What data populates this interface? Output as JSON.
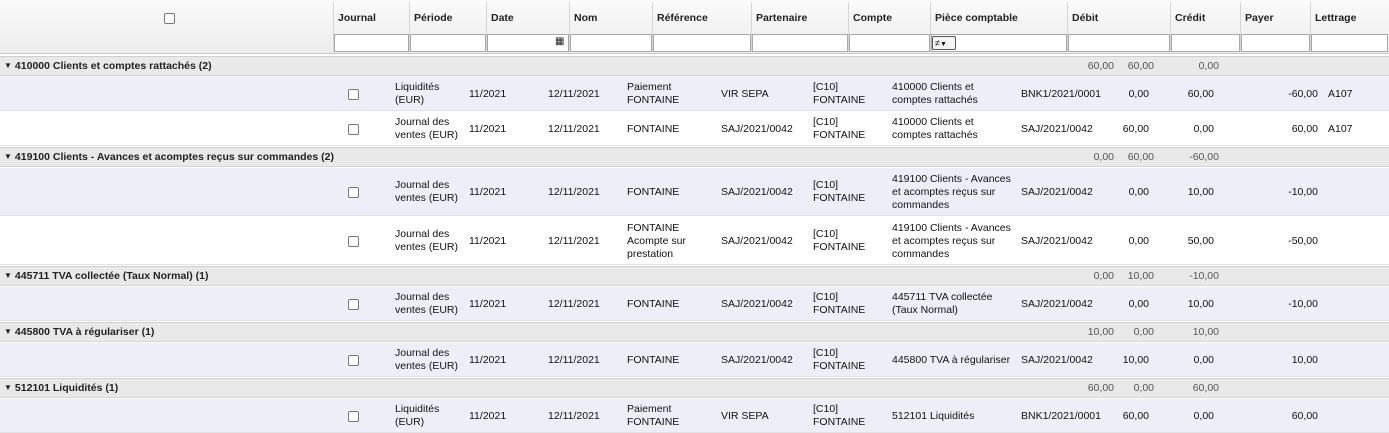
{
  "columns": [
    "Journal",
    "Période",
    "Date",
    "Nom",
    "Référence",
    "Partenaire",
    "Compte",
    "Pièce comptable",
    "Débit",
    "Crédit",
    "Payer",
    "Lettrage"
  ],
  "filter": {
    "piece_operator": "≠"
  },
  "groups": [
    {
      "title": "410000 Clients et comptes rattachés (2)",
      "debit": "60,00",
      "credit": "60,00",
      "payer": "0,00",
      "rows": [
        {
          "journal": "Liquidités (EUR)",
          "periode": "11/2021",
          "date": "12/11/2021",
          "nom": "Paiement FONTAINE",
          "reference": "VIR SEPA",
          "partenaire": "[C10] FONTAINE",
          "compte": "410000 Clients et comptes rattachés",
          "piece": "BNK1/2021/0001",
          "debit": "0,00",
          "credit": "60,00",
          "payer": "-60,00",
          "lettrage": "A107"
        },
        {
          "journal": "Journal des ventes (EUR)",
          "periode": "11/2021",
          "date": "12/11/2021",
          "nom": "FONTAINE",
          "reference": "SAJ/2021/0042",
          "partenaire": "[C10] FONTAINE",
          "compte": "410000 Clients et comptes rattachés",
          "piece": "SAJ/2021/0042",
          "debit": "60,00",
          "credit": "0,00",
          "payer": "60,00",
          "lettrage": "A107"
        }
      ]
    },
    {
      "title": "419100 Clients - Avances et acomptes reçus sur commandes (2)",
      "debit": "0,00",
      "credit": "60,00",
      "payer": "-60,00",
      "rows": [
        {
          "journal": "Journal des ventes (EUR)",
          "periode": "11/2021",
          "date": "12/11/2021",
          "nom": "FONTAINE",
          "reference": "SAJ/2021/0042",
          "partenaire": "[C10] FONTAINE",
          "compte": "419100 Clients - Avances et acomptes reçus sur commandes",
          "piece": "SAJ/2021/0042",
          "debit": "0,00",
          "credit": "10,00",
          "payer": "-10,00",
          "lettrage": ""
        },
        {
          "journal": "Journal des ventes (EUR)",
          "periode": "11/2021",
          "date": "12/11/2021",
          "nom": "FONTAINE Acompte sur prestation",
          "reference": "SAJ/2021/0042",
          "partenaire": "[C10] FONTAINE",
          "compte": "419100 Clients - Avances et acomptes reçus sur commandes",
          "piece": "SAJ/2021/0042",
          "debit": "0,00",
          "credit": "50,00",
          "payer": "-50,00",
          "lettrage": ""
        }
      ]
    },
    {
      "title": "445711 TVA collectée (Taux Normal) (1)",
      "debit": "0,00",
      "credit": "10,00",
      "payer": "-10,00",
      "rows": [
        {
          "journal": "Journal des ventes (EUR)",
          "periode": "11/2021",
          "date": "12/11/2021",
          "nom": "FONTAINE",
          "reference": "SAJ/2021/0042",
          "partenaire": "[C10] FONTAINE",
          "compte": "445711 TVA collectée (Taux Normal)",
          "piece": "SAJ/2021/0042",
          "debit": "0,00",
          "credit": "10,00",
          "payer": "-10,00",
          "lettrage": ""
        }
      ]
    },
    {
      "title": "445800 TVA à régulariser (1)",
      "debit": "10,00",
      "credit": "0,00",
      "payer": "10,00",
      "rows": [
        {
          "journal": "Journal des ventes (EUR)",
          "periode": "11/2021",
          "date": "12/11/2021",
          "nom": "FONTAINE",
          "reference": "SAJ/2021/0042",
          "partenaire": "[C10] FONTAINE",
          "compte": "445800 TVA à régulariser",
          "piece": "SAJ/2021/0042",
          "debit": "10,00",
          "credit": "0,00",
          "payer": "10,00",
          "lettrage": ""
        }
      ]
    },
    {
      "title": "512101 Liquidités (1)",
      "debit": "60,00",
      "credit": "0,00",
      "payer": "60,00",
      "rows": [
        {
          "journal": "Liquidités (EUR)",
          "periode": "11/2021",
          "date": "12/11/2021",
          "nom": "Paiement FONTAINE",
          "reference": "VIR SEPA",
          "partenaire": "[C10] FONTAINE",
          "compte": "512101 Liquidités",
          "piece": "BNK1/2021/0001",
          "debit": "60,00",
          "credit": "0,00",
          "payer": "60,00",
          "lettrage": ""
        }
      ]
    }
  ]
}
